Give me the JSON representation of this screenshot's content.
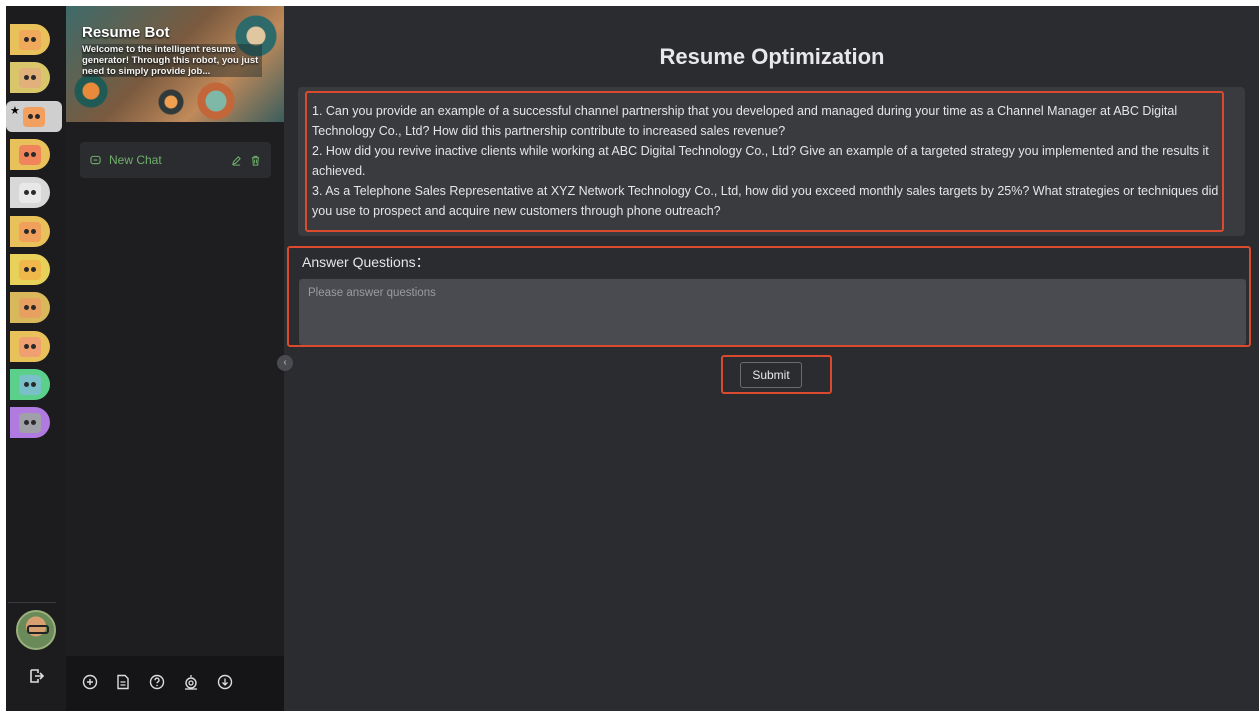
{
  "sidebar": {
    "bot_name": "Resume Bot",
    "bot_description": "Welcome to the intelligent resume generator! Through this robot, you just need to simply provide job...",
    "chats": [
      {
        "label": "New Chat"
      }
    ]
  },
  "rail": {
    "bots": [
      {
        "name": "bot-1",
        "color": "#f0a85a",
        "bg": "#e8c15a"
      },
      {
        "name": "bot-2",
        "color": "#e2b07a",
        "bg": "#d9c66a"
      },
      {
        "name": "bot-3",
        "color": "#f2a060",
        "bg": "#cfcfcf",
        "active": true
      },
      {
        "name": "bot-4",
        "color": "#f0845a",
        "bg": "#e8c15a"
      },
      {
        "name": "bot-5",
        "color": "#e8e8e8",
        "bg": "#d8d8d8"
      },
      {
        "name": "bot-6",
        "color": "#f0a05a",
        "bg": "#e8c15a"
      },
      {
        "name": "bot-7",
        "color": "#f0b84a",
        "bg": "#e8d15a"
      },
      {
        "name": "bot-8",
        "color": "#e8a060",
        "bg": "#d8b85a"
      },
      {
        "name": "bot-9",
        "color": "#f0a070",
        "bg": "#e8c15a"
      },
      {
        "name": "bot-10",
        "color": "#7ac0c8",
        "bg": "#5ad08a"
      },
      {
        "name": "bot-11",
        "color": "#a0a0a8",
        "bg": "#b07ae0"
      }
    ],
    "active_marker": "★"
  },
  "main": {
    "title": "Resume Optimization",
    "questions": [
      "1. Can you provide an example of a successful channel partnership that you developed and managed during your time as a Channel Manager at ABC Digital Technology Co., Ltd? How did this partnership contribute to increased sales revenue?",
      "2. How did you revive inactive clients while working at ABC Digital Technology Co., Ltd? Give an example of a targeted strategy you implemented and the results it achieved.",
      "3. As a Telephone Sales Representative at XYZ Network Technology Co., Ltd, how did you exceed monthly sales targets by 25%? What strategies or techniques did you use to prospect and acquire new customers through phone outreach?"
    ],
    "answer_label": "Answer Questions：",
    "answer_placeholder": "Please answer questions",
    "answer_value": "",
    "submit_label": "Submit"
  },
  "icons": {
    "chat": "chat-bubble-icon",
    "edit": "pencil-icon",
    "delete": "trash-icon",
    "collapse": "chevron-left-icon",
    "footer": [
      "add-circle-icon",
      "document-icon",
      "help-circle-icon",
      "robot-icon",
      "download-icon"
    ],
    "logout": "logout-icon"
  },
  "colors": {
    "highlight": "#d94a2e",
    "chat_accent": "#6fb06a",
    "background": "#2b2c30"
  }
}
